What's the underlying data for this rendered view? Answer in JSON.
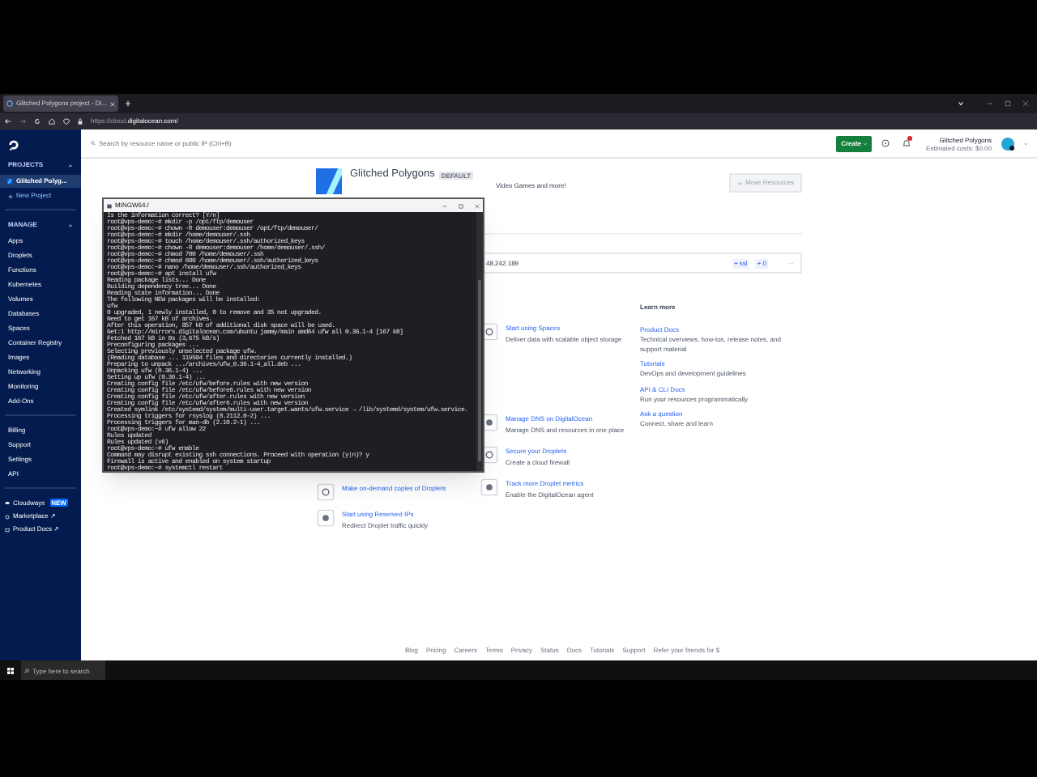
{
  "browser": {
    "tab": "Glitched Polygons project - Di...",
    "url_muted": "https://cloud.",
    "url_host": "digitalocean.com/"
  },
  "sidebar": {
    "projects_heading": "PROJECTS",
    "projects": [
      {
        "label": "Glitched Polyg...",
        "selected": true
      }
    ],
    "new_project": "New Project",
    "manage_heading": "MANAGE",
    "manage_items": [
      "Apps",
      "Droplets",
      "Functions",
      "Kubernetes",
      "Volumes",
      "Databases",
      "Spaces",
      "Container Registry",
      "Images",
      "Networking",
      "Monitoring",
      "Add-Ons"
    ],
    "account_items": [
      "Billing",
      "Support",
      "Settings",
      "API"
    ],
    "extra_items": [
      {
        "kind": "cloud",
        "label": "Cloudways",
        "badge": "NEW"
      },
      {
        "kind": "market",
        "label": "Marketplace ↗"
      },
      {
        "kind": "docs",
        "label": "Product Docs ↗"
      }
    ]
  },
  "header": {
    "search_placeholder": "Search by resource name or public IP (Ctrl+B)",
    "create": "Create",
    "account_name": "Glitched Polygons",
    "account_cost": "Estimated costs: $0.00"
  },
  "project": {
    "name": "Glitched Polygons",
    "badge": "DEFAULT",
    "description": "Video Games and more!",
    "move_button": "Move Resources",
    "resource_ip": "48.242.189",
    "resource_tags": [
      "+ ssl",
      "+ 0"
    ],
    "more": "···"
  },
  "left_cards": [
    {
      "title": "Make on-demand copies of Droplets"
    },
    {
      "title": "Start using Reserved IPs",
      "desc": "Redirect Droplet traffic quickly"
    }
  ],
  "middle_cards": [
    {
      "title": "Start using Spaces",
      "desc": "Deliver data with scalable object storage"
    },
    {
      "title": "Manage DNS on DigitalOcean",
      "desc": "Manage DNS and resources in one place"
    },
    {
      "title": "Secure your Droplets",
      "desc": "Create a cloud firewall"
    },
    {
      "title": "Track more Droplet metrics",
      "desc": "Enable the DigitalOcean agent"
    }
  ],
  "learn_more": {
    "heading": "Learn more",
    "links": [
      {
        "title": "Product Docs",
        "desc": "Technical overviews, how-tos, release notes, and support material"
      },
      {
        "title": "Tutorials",
        "desc": "DevOps and development guidelines"
      },
      {
        "title": "API & CLI Docs",
        "desc": "Run your resources programmatically"
      },
      {
        "title": "Ask a question",
        "desc": "Connect, share and learn"
      }
    ]
  },
  "footer": [
    "Blog",
    "Pricing",
    "Careers",
    "Terms",
    "Privacy",
    "Status",
    "Docs",
    "Tutorials",
    "Support",
    "Refer your friends for $"
  ],
  "terminal": {
    "title": "MINGW64:/",
    "lines": [
      "Is the information correct? [Y/n]",
      "root@vps-demo:~# mkdir -p /opt/ftp/demouser",
      "root@vps-demo:~# chown -R demouser:demouser /opt/ftp/demouser/",
      "root@vps-demo:~# mkdir /home/demouser/.ssh",
      "root@vps-demo:~# touch /home/demouser/.ssh/authorized_keys",
      "root@vps-demo:~# chown -R demouser:demouser /home/demouser/.ssh/",
      "root@vps-demo:~# chmod 700 /home/demouser/.ssh",
      "root@vps-demo:~# chmod 600 /home/demouser/.ssh/authorized_keys",
      "root@vps-demo:~# nano /home/demouser/.ssh/authorized_keys",
      "root@vps-demo:~# apt install ufw",
      "Reading package lists... Done",
      "Building dependency tree... Done",
      "Reading state information... Done",
      "The following NEW packages will be installed:",
      "  ufw",
      "0 upgraded, 1 newly installed, 0 to remove and 35 not upgraded.",
      "Need to get 167 kB of archives.",
      "After this operation, 857 kB of additional disk space will be used.",
      "Get:1 http://mirrors.digitalocean.com/ubuntu jammy/main amd64 ufw all 0.36.1-4 [167 kB]",
      "Fetched 167 kB in 0s (3,675 kB/s)",
      "Preconfiguring packages ...",
      "Selecting previously unselected package ufw.",
      "(Reading database ... 119504 files and directories currently installed.)",
      "Preparing to unpack .../archives/ufw_0.36.1-4_all.deb ...",
      "Unpacking ufw (0.36.1-4) ...",
      "Setting up ufw (0.36.1-4) ...",
      "Creating config file /etc/ufw/before.rules with new version",
      "Creating config file /etc/ufw/before6.rules with new version",
      "Creating config file /etc/ufw/after.rules with new version",
      "Creating config file /etc/ufw/after6.rules with new version",
      "Created symlink /etc/systemd/system/multi-user.target.wants/ufw.service → /lib/systemd/system/ufw.service.",
      "Processing triggers for rsyslog (8.2112.0-2) ...",
      "Processing triggers for man-db (2.10.2-1) ...",
      "root@vps-demo:~# ufw allow 22",
      "Rules updated",
      "Rules updated (v6)",
      "root@vps-demo:~# ufw enable",
      "Command may disrupt existing ssh connections. Proceed with operation (y|n)? y",
      "Firewall is active and enabled on system startup",
      "root@vps-demo:~# systemctl restart"
    ]
  },
  "taskbar": {
    "search_placeholder": "Type here to search"
  }
}
